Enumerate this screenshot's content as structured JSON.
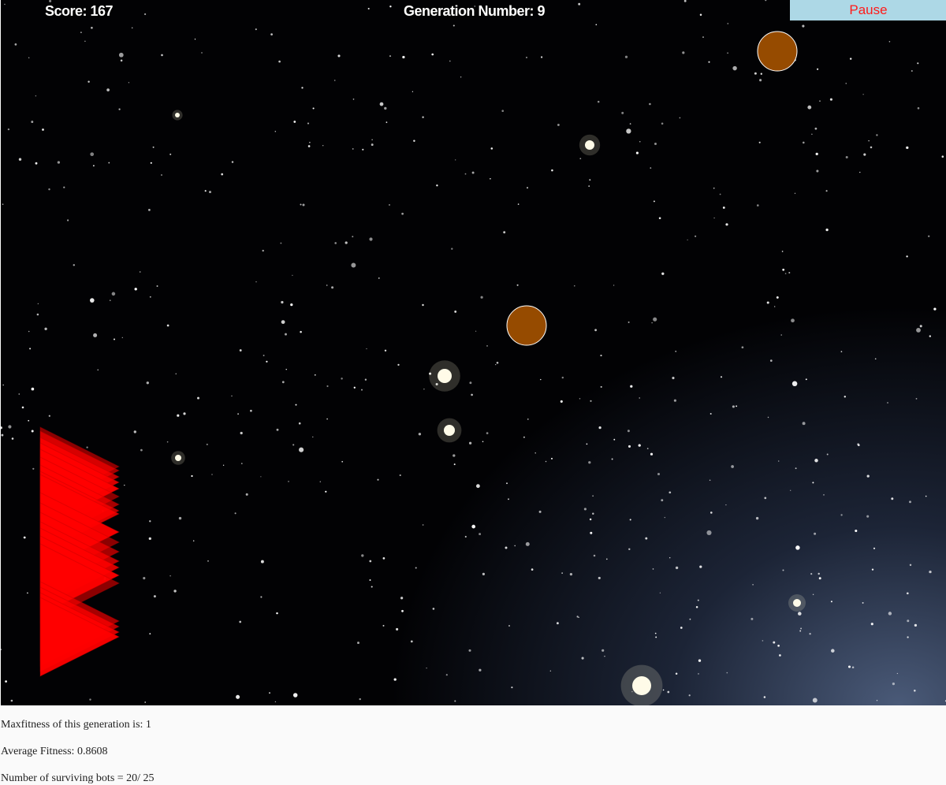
{
  "hud": {
    "score_text": "Score: 167",
    "generation_text": "Generation Number: 9",
    "pause_label": "Pause"
  },
  "stats": {
    "max_fitness_text": "Maxfitness of this generation is: 1",
    "average_fitness_text": "Average Fitness: 0.8608",
    "survivors_text": "Number of surviving bots = 20/ 25"
  },
  "game": {
    "score": 167,
    "generation": 9,
    "max_fitness": 1,
    "average_fitness": 0.8608,
    "surviving_bots": 20,
    "total_bots": 25,
    "visible_asteroids": 2,
    "icons": {
      "bot": "red-triangle-ship-icon",
      "asteroid": "brown-circle-asteroid-icon"
    }
  },
  "colors": {
    "background": "#020204",
    "bot": "#ff0000",
    "asteroid": "#964b00",
    "asteroid_outline": "#ffffff",
    "hud_text": "#ffffff",
    "pause_bg": "#add8e6",
    "pause_text": "#ff1a1a"
  }
}
